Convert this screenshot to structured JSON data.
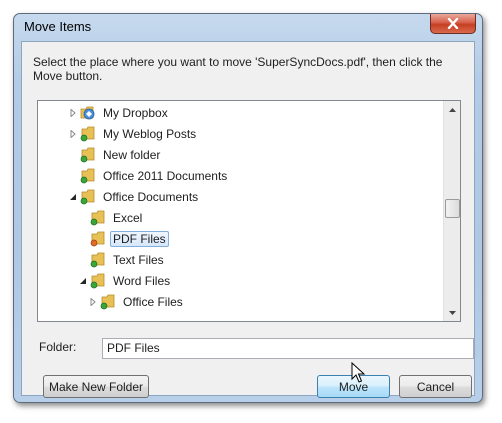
{
  "window": {
    "title": "Move Items",
    "instructions": "Select the place where you want to move 'SuperSyncDocs.pdf', then click the Move button."
  },
  "tree": {
    "items": [
      {
        "label": "My Dropbox",
        "expander": "collapsed",
        "icon": "dropbox-folder-icon",
        "selected": false
      },
      {
        "label": "My Weblog Posts",
        "expander": "collapsed",
        "icon": "folder-sync-icon",
        "selected": false
      },
      {
        "label": "New folder",
        "expander": "none",
        "icon": "folder-sync-icon",
        "selected": false
      },
      {
        "label": "Office 2011 Documents",
        "expander": "none",
        "icon": "folder-sync-icon",
        "selected": false
      },
      {
        "label": "Office Documents",
        "expander": "expanded",
        "icon": "folder-sync-icon",
        "selected": false
      },
      {
        "label": "Excel",
        "expander": "none",
        "icon": "folder-sync-icon",
        "selected": false
      },
      {
        "label": "PDF Files",
        "expander": "none",
        "icon": "folder-sync-icon",
        "selected": true
      },
      {
        "label": "Text Files",
        "expander": "none",
        "icon": "folder-sync-icon",
        "selected": false
      },
      {
        "label": "Word Files",
        "expander": "expanded",
        "icon": "folder-sync-icon",
        "selected": false
      },
      {
        "label": "Office Files",
        "expander": "collapsed",
        "icon": "folder-sync-icon",
        "selected": false
      }
    ]
  },
  "folder_field": {
    "label": "Folder:",
    "value": "PDF Files"
  },
  "buttons": {
    "new_folder": "Make New Folder",
    "move": "Move",
    "cancel": "Cancel"
  },
  "colors": {
    "selection_border": "#84acdd",
    "folder_yellow": "#e8c156",
    "sync_green": "#3aa53a",
    "close_red": "#c63f22"
  }
}
